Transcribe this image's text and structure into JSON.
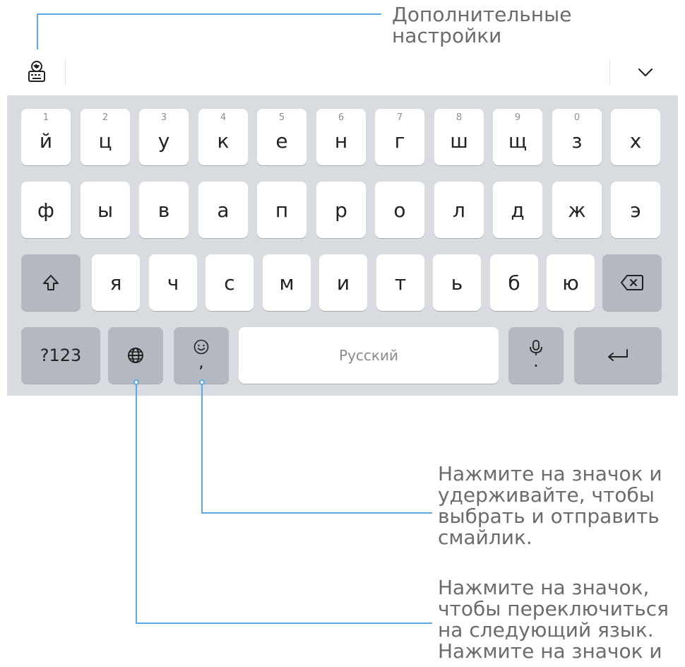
{
  "callouts": {
    "settings": "Дополнительные настройки",
    "emoji": "Нажмите на значок и\nудерживайте, чтобы\nвыбрать и отправить\nсмайлик.",
    "language": "Нажмите на значок,\nчтобы переключиться\nна следующий язык.\nНажмите на значок и"
  },
  "toolbar": {
    "left_icon": "keyboard-settings-globe-icon",
    "right_icon": "chevron-down-icon"
  },
  "rows": {
    "row1": [
      {
        "num": "1",
        "char": "й"
      },
      {
        "num": "2",
        "char": "ц"
      },
      {
        "num": "3",
        "char": "у"
      },
      {
        "num": "4",
        "char": "к"
      },
      {
        "num": "5",
        "char": "е"
      },
      {
        "num": "6",
        "char": "н"
      },
      {
        "num": "7",
        "char": "г"
      },
      {
        "num": "8",
        "char": "ш"
      },
      {
        "num": "9",
        "char": "щ"
      },
      {
        "num": "0",
        "char": "з"
      },
      {
        "num": "",
        "char": "х"
      }
    ],
    "row2": [
      "ф",
      "ы",
      "в",
      "а",
      "п",
      "р",
      "о",
      "л",
      "д",
      "ж",
      "э"
    ],
    "row3": [
      "я",
      "ч",
      "с",
      "м",
      "и",
      "т",
      "ь",
      "б",
      "ю"
    ]
  },
  "bottom": {
    "numbers_label": "?123",
    "emoji_sub": ",",
    "space_label": "Русский",
    "mic_sub": "."
  },
  "colors": {
    "accent": "#5aa9e6",
    "keyboard_bg": "#d8dbe0",
    "function_key": "#b3b8c1"
  }
}
